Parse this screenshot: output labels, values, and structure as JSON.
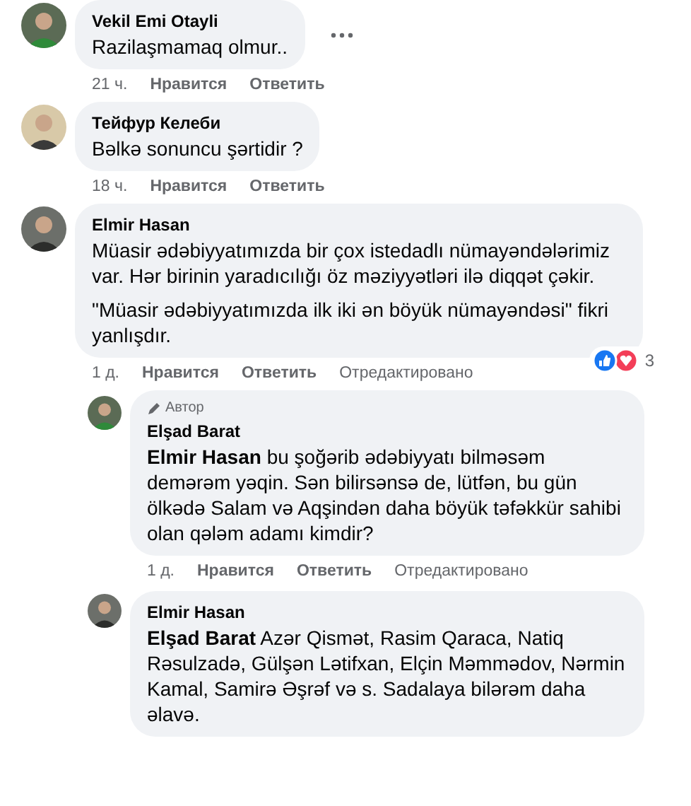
{
  "comments": [
    {
      "author": "Vekil Emi Otayli",
      "paragraphs": [
        "Razilaşmamaq olmur.."
      ],
      "more_button": true,
      "actions": {
        "time": "21 ч.",
        "like": "Нравится",
        "reply": "Ответить"
      }
    },
    {
      "author": "Тейфур Келеби",
      "paragraphs": [
        "Bəlkə sonuncu şərtidir ?"
      ],
      "actions": {
        "time": "18 ч.",
        "like": "Нравится",
        "reply": "Ответить"
      }
    },
    {
      "author": "Elmir Hasan",
      "paragraphs": [
        "Müasir ədəbiyyatımızda bir çox istedadlı nümayəndələrimiz var. Hər birinin yaradıcılığı öz məziyyətləri ilə diqqət çəkir.",
        "\"Müasir ədəbiyyatımızda ilk iki ən böyük nümayəndəsi\" fikri yanlışdır."
      ],
      "actions": {
        "time": "1 д.",
        "like": "Нравится",
        "reply": "Ответить",
        "edited": "Отредактировано"
      },
      "reactions": {
        "count": "3"
      },
      "replies": [
        {
          "author": "Elşad Barat",
          "badge": "Автор",
          "paragraphs": [
            "**Elmir Hasan** bu şoğərib ədəbiyyatı bilməsəm demərəm yəqin. Sən bilirsənsə de, lütfən, bu gün ölkədə Salam və Aqşindən daha böyük təfəkkür sahibi olan qələm adamı kimdir?"
          ],
          "actions": {
            "time": "1 д.",
            "like": "Нравится",
            "reply": "Ответить",
            "edited": "Отредактировано"
          }
        },
        {
          "author": "Elmir Hasan",
          "paragraphs": [
            "**Elşad Barat** Azər Qismət, Rasim Qaraca, Natiq Rəsulzadə, Gülşən Lətifxan, Elçin Məmmədov, Nərmin Kamal, Samirə Əşrəf və s. Sadalaya bilərəm daha əlavə."
          ]
        }
      ]
    }
  ]
}
